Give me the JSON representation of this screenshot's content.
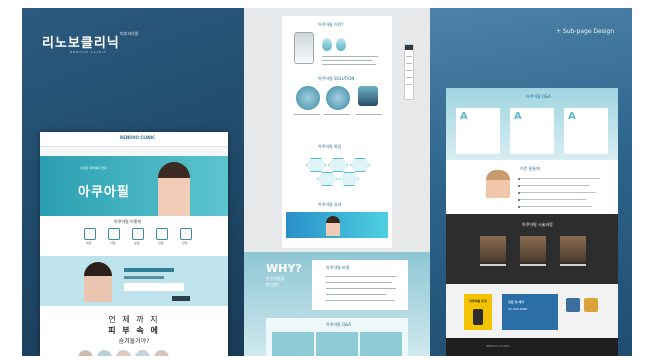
{
  "left": {
    "brand_korean": "리노보클리닉",
    "brand_small": "피부과의원",
    "brand_sub": "RENOVO CLINIC",
    "site": {
      "logo": "RENOVO CLINIC",
      "hero_small": "미세한 피부결의 변화",
      "hero_title": "아쿠아필",
      "section_title": "아쿠아필 이렇게",
      "icon_labels": [
        "세정",
        "각질",
        "보습",
        "진정",
        "관리"
      ],
      "headline_1": "언 제 까 지",
      "headline_2": "피 부 속 에",
      "headline_3": "숨겨둘거야?"
    }
  },
  "middle": {
    "top_title": "아쿠아필 이란?",
    "solution_title": "아쿠아필 SOLUTION",
    "feature_title": "아쿠아필 특징",
    "effect_title": "아쿠아필 효과",
    "why_title": "WHY?",
    "why_sub": "아쿠아필을\n한다면?",
    "card_title": "아쿠아필 비결",
    "qa_title": "아쿠아필 Q&A"
  },
  "right": {
    "tag": "+ Sub-page Design",
    "qa_title": "아쿠아필 Q&A",
    "recommend_title": "이런 분들께",
    "dark_title": "아쿠아필 시술과정",
    "yellow_title": "아쿠아필 문의",
    "blue_line1": "상담 및 예약",
    "blue_line2": "02-000-0000",
    "footer": "RENOVO CLINIC"
  },
  "colors": {
    "brand": "#2d6f8e",
    "accent": "#5cc4cf",
    "bg_left": "#1f4767",
    "bg_right": "#2e658c"
  }
}
